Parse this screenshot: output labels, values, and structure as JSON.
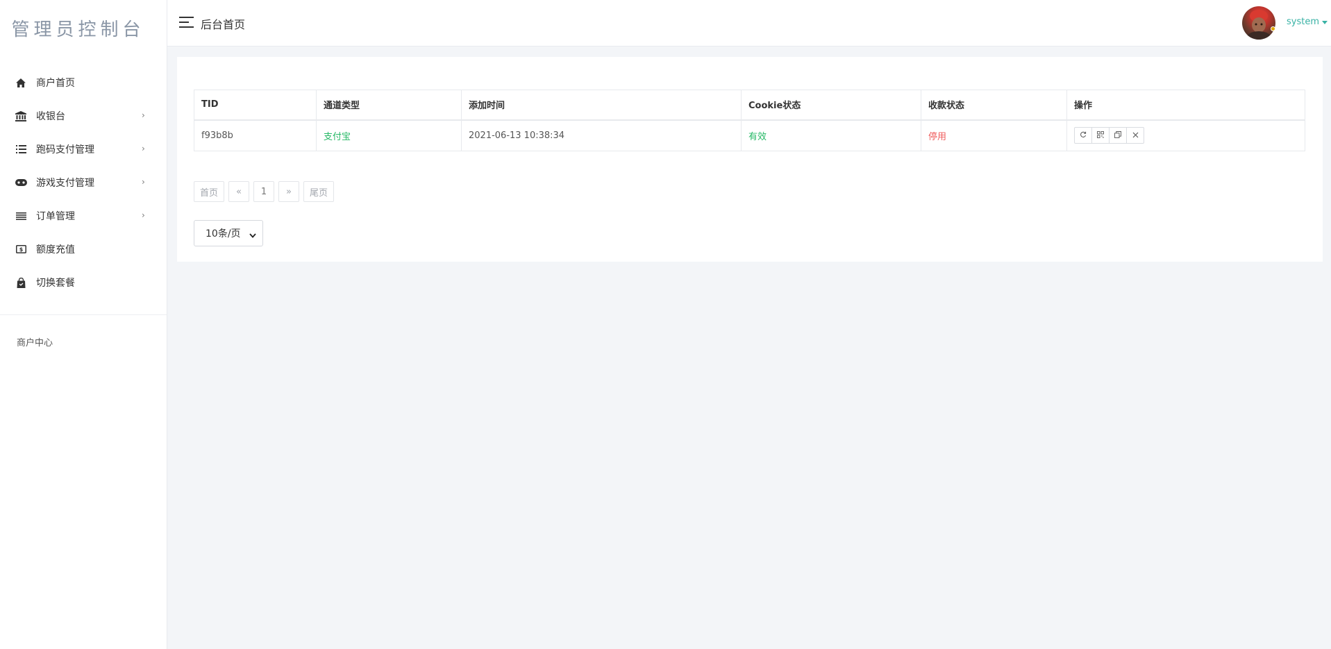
{
  "sidebar": {
    "brand": "管理员控制台",
    "items": [
      {
        "label": "商户首页",
        "icon": "home-icon",
        "has_arrow": false
      },
      {
        "label": "收银台",
        "icon": "bank-icon",
        "has_arrow": true
      },
      {
        "label": "跑码支付管理",
        "icon": "list-icon",
        "has_arrow": true
      },
      {
        "label": "游戏支付管理",
        "icon": "gamepad-icon",
        "has_arrow": true
      },
      {
        "label": "订单管理",
        "icon": "menu-lines-icon",
        "has_arrow": true
      },
      {
        "label": "额度充值",
        "icon": "money-icon",
        "has_arrow": false
      },
      {
        "label": "切换套餐",
        "icon": "shopping-bag-icon",
        "has_arrow": false
      }
    ],
    "arrow": "›",
    "section_label": "商户中心"
  },
  "header": {
    "title": "后台首页",
    "user": "system"
  },
  "table": {
    "headers": [
      "TID",
      "通道类型",
      "添加时间",
      "Cookie状态",
      "收款状态",
      "操作"
    ],
    "rows": [
      {
        "tid": "f93b8b",
        "channel": "支付宝",
        "added": "2021-06-13 10:38:34",
        "cookie_status": "有效",
        "pay_status": "停用",
        "actions": [
          "refresh-icon",
          "qrcode-icon",
          "copy-icon",
          "delete-icon"
        ]
      }
    ]
  },
  "pagination": {
    "first": "首页",
    "prev": "«",
    "current": "1",
    "next": "»",
    "last": "尾页",
    "page_size": "10条/页"
  },
  "colors": {
    "accent": "#39b2a5",
    "success": "#25b865",
    "danger": "#ef5a5a"
  }
}
